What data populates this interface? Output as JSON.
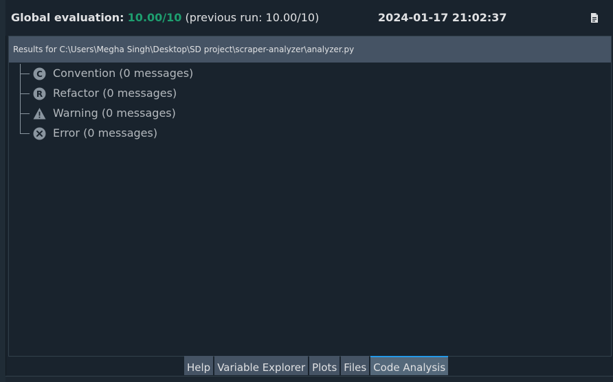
{
  "header": {
    "eval_label": "Global evaluation:",
    "score": "10.00/10",
    "previous_run": "(previous run: 10.00/10)",
    "timestamp": "2024-01-17 21:02:37",
    "doc_icon": "document-icon"
  },
  "results": {
    "header_text": "Results for C:\\Users\\Megha Singh\\Desktop\\SD project\\scraper-analyzer\\analyzer.py",
    "items": [
      {
        "label": "Convention (0 messages)",
        "icon": "convention-icon",
        "icon_letter": "C"
      },
      {
        "label": "Refactor (0 messages)",
        "icon": "refactor-icon",
        "icon_letter": "R"
      },
      {
        "label": "Warning (0 messages)",
        "icon": "warning-icon"
      },
      {
        "label": "Error (0 messages)",
        "icon": "error-icon"
      }
    ]
  },
  "tabs": [
    {
      "label": "Help",
      "active": false
    },
    {
      "label": "Variable Explorer",
      "active": false
    },
    {
      "label": "Plots",
      "active": false
    },
    {
      "label": "Files",
      "active": false
    },
    {
      "label": "Code Analysis",
      "active": true
    }
  ],
  "colors": {
    "background": "#19232d",
    "score_green": "#1e9e6f",
    "header_bar": "#455364",
    "tab_active_accent": "#259ae9",
    "tree_text": "#b4b9be"
  }
}
